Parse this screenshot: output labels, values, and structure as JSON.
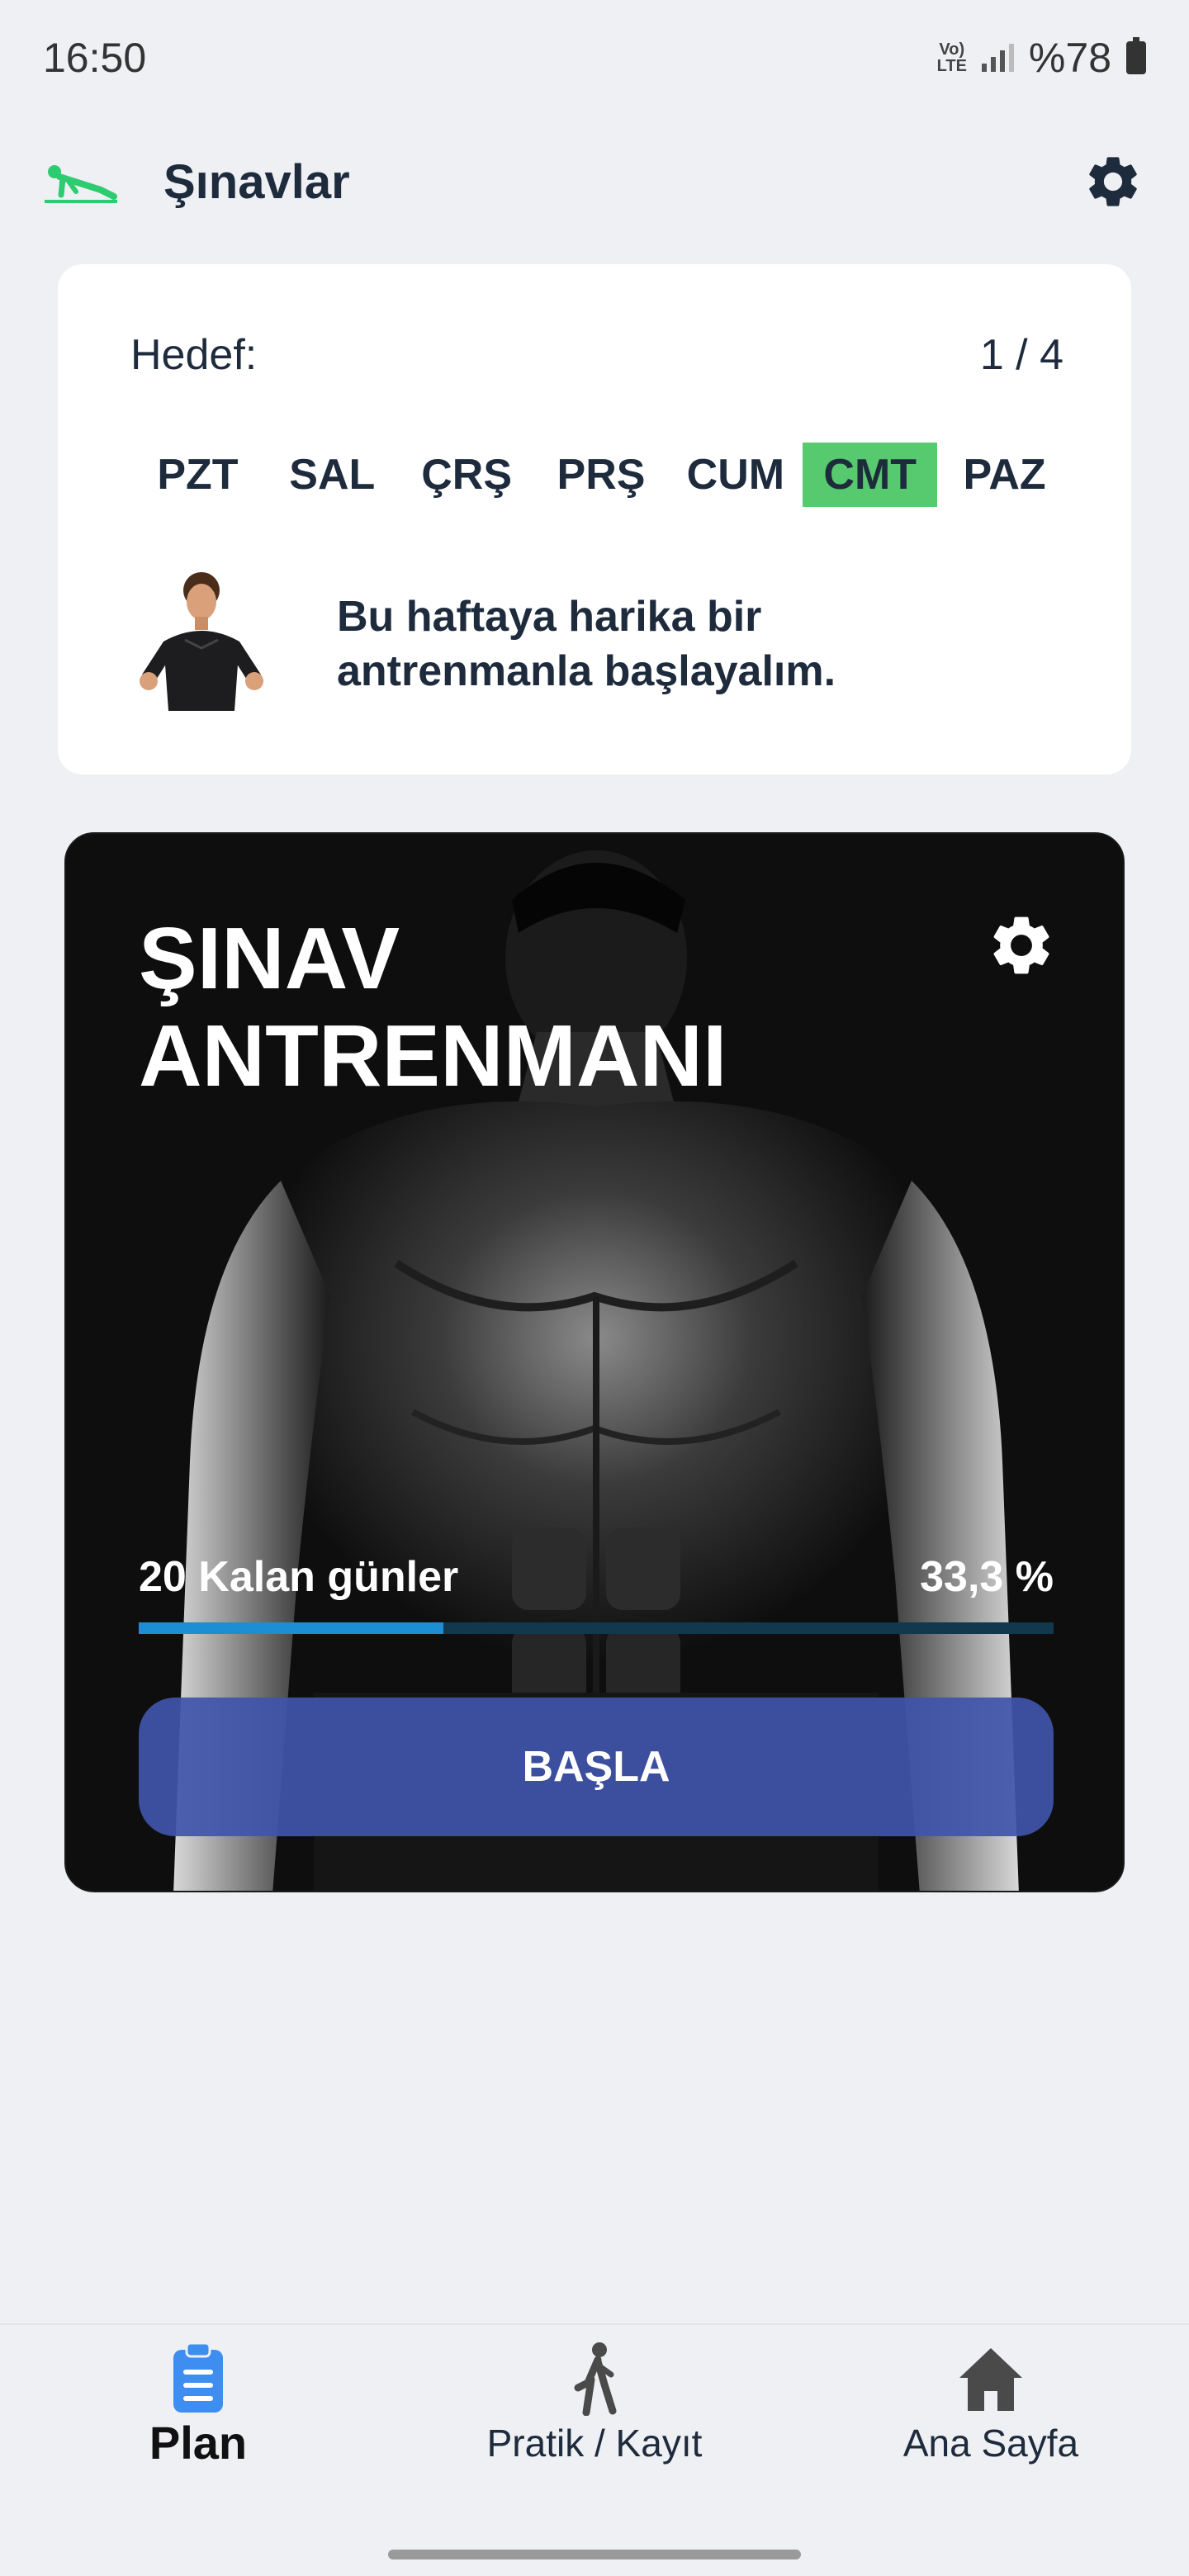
{
  "status_bar": {
    "time": "16:50",
    "volte_line1": "Vo)",
    "volte_line2": "LTE",
    "battery": "%78"
  },
  "app_bar": {
    "title": "Şınavlar",
    "logo_icon": "pushup-icon",
    "settings_icon": "gear-icon",
    "accent_color": "#2ecc71"
  },
  "goal": {
    "label": "Hedef:",
    "progress": "1 / 4",
    "days": [
      "PZT",
      "SAL",
      "ÇRŞ",
      "PRŞ",
      "CUM",
      "CMT",
      "PAZ"
    ],
    "active_day_index": 5,
    "active_day_color": "#57c96e",
    "message": "Bu haftaya harika bir antrenmanla başlayalım."
  },
  "workout": {
    "title_line1": "ŞINAV",
    "title_line2": "ANTRENMANI",
    "remaining_days": "20 Kalan günler",
    "percent_text": "33,3 %",
    "progress_value": 0.333,
    "start_label": "BAŞLA",
    "button_color": "#4054aa",
    "progress_color": "#1c8fd4"
  },
  "bottom_nav": {
    "items": [
      {
        "label": "Plan",
        "icon": "clipboard-icon",
        "active": true
      },
      {
        "label": "Pratik / Kayıt",
        "icon": "exercise-person-icon",
        "active": false
      },
      {
        "label": "Ana Sayfa",
        "icon": "home-icon",
        "active": false
      }
    ]
  }
}
